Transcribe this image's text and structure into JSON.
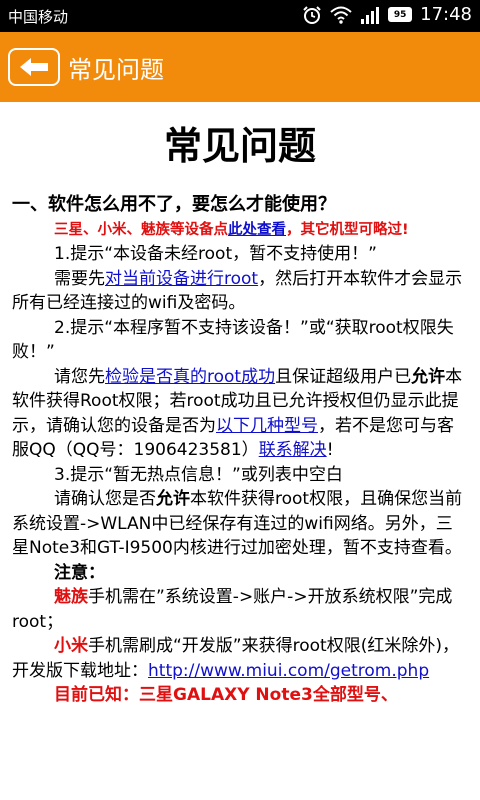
{
  "status_bar": {
    "carrier": "中国移动",
    "battery": "95",
    "time": "17:48"
  },
  "title_bar": {
    "title": "常见问题"
  },
  "page": {
    "heading": "常见问题",
    "q1": "一、软件怎么用不了，要怎么才能使用？",
    "note1_a": "三星、小米、魅族等设备点",
    "note1_link": "此处查看",
    "note1_b": "，其它机型可略过!",
    "t1": "1.提示“本设备未经root，暂不支持使用！”",
    "t1_a": "需要先",
    "t1_link": "对当前设备进行root",
    "t1_b": "，然后打开本软件才会显示所有已经连接过的wifi及密码。",
    "t2": "2.提示“本程序暂不支持该设备！”或“获取root权限失败！”",
    "t2_a": "请您先",
    "t2_link1": "检验是否真的root成功",
    "t2_b": "且保证超级用户已",
    "t2_bold": "允许",
    "t2_c": "本软件获得Root权限；若root成功且已允许授权但仍显示此提示，请确认您的设备是否为",
    "t2_link2": "以下几种型号",
    "t2_d": "，若不是您可与客服QQ（QQ号：1906423581）",
    "t2_link3": "联系解决",
    "t2_e": "!",
    "t3": "3.提示“暂无热点信息！”或列表中空白",
    "t3_a": "请确认您是否",
    "t3_bold": "允许",
    "t3_b": "本软件获得root权限，且确保您当前系统设置->WLAN中已经保存有连过的wifi网络。另外，三星Note3和GT-I9500内核进行过加密处理，暂不支持查看。",
    "notice": "注意：",
    "meizu": "魅族",
    "meizu_text": "手机需在”系统设置->账户->开放系统权限”完成root；",
    "xiaomi": "小米",
    "xiaomi_text": "手机需刷成“开发版”来获得root权限(红米除外)，开发版下载地址：",
    "xiaomi_url": "http://www.miui.com/getrom.php",
    "known": "目前已知：三星GALAXY Note3全部型号、"
  }
}
